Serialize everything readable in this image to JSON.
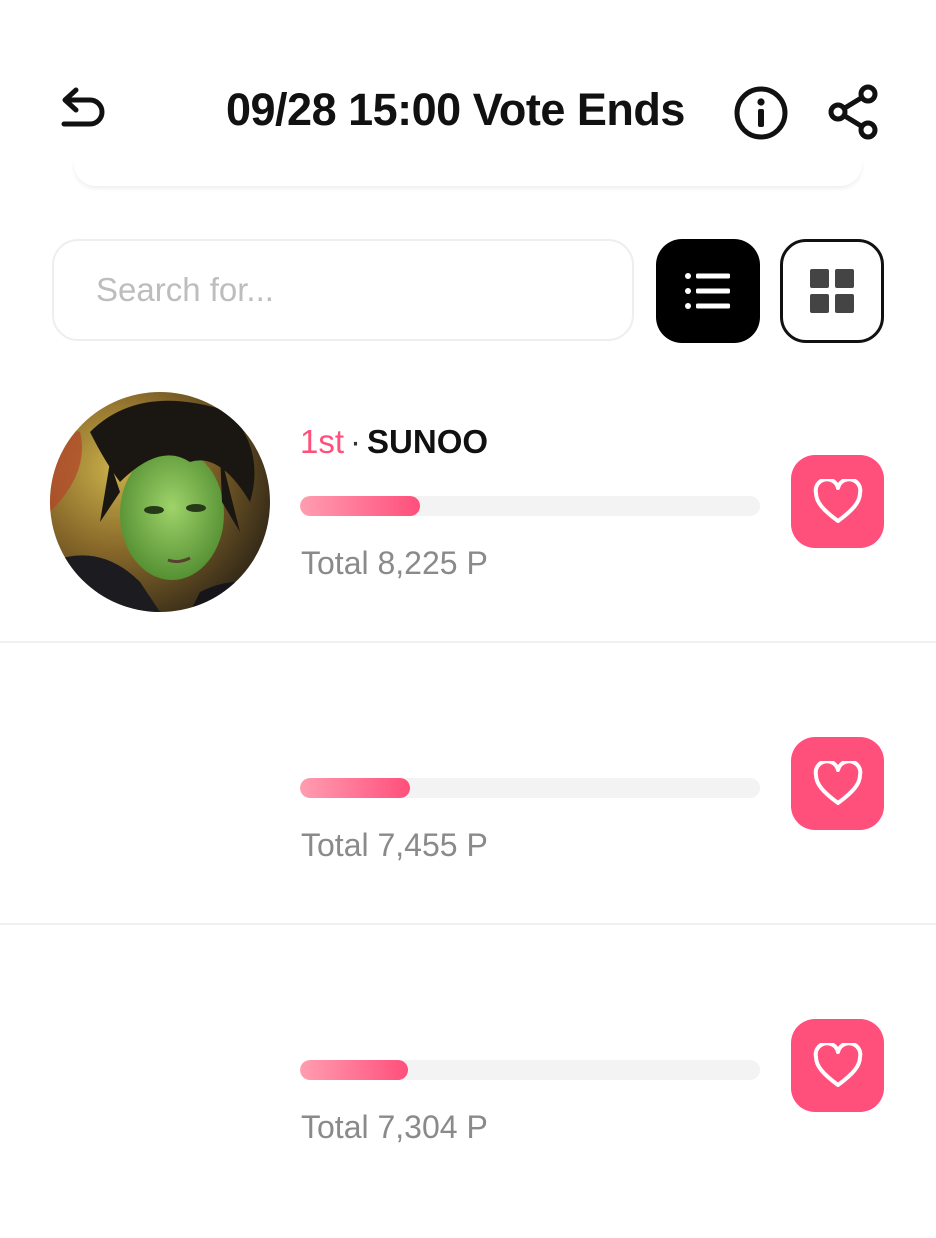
{
  "header": {
    "title": "09/28 15:00 Vote Ends",
    "back_icon": "undo-arrow-icon",
    "info_icon": "info-circle-icon",
    "share_icon": "share-icon"
  },
  "search": {
    "placeholder": "Search for...",
    "value": ""
  },
  "view_toggle": {
    "active": "list",
    "list_icon": "list-icon",
    "grid_icon": "grid-icon"
  },
  "candidates": [
    {
      "rank": "1st",
      "separator": "·",
      "name": "SUNOO",
      "progress_fraction": 0.26,
      "total": "Total 8,225 P",
      "vote_icon": "heart-icon"
    },
    {
      "rank": "",
      "separator": "",
      "name": "",
      "progress_fraction": 0.24,
      "total": "Total 7,455 P",
      "vote_icon": "heart-icon"
    },
    {
      "rank": "",
      "separator": "",
      "name": "",
      "progress_fraction": 0.235,
      "total": "Total 7,304 P",
      "vote_icon": "heart-icon"
    }
  ],
  "colors": {
    "accent": "#ff4f7b",
    "accent_light": "#ff9db0",
    "track": "#f3f3f3",
    "muted_text": "#8a8a8a",
    "dark": "#000000"
  }
}
